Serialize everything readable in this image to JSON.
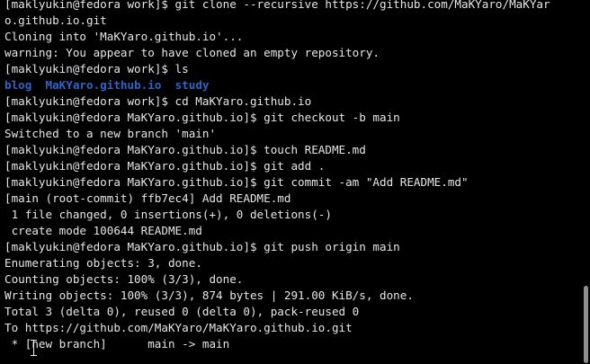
{
  "terminal": {
    "lines": [
      {
        "text": "[maklyukin@fedora work]$ git clone --recursive https://github.com/MaKYaro/MaKYar"
      },
      {
        "text": "o.github.io.git"
      },
      {
        "text": "Cloning into 'MaKYaro.github.io'..."
      },
      {
        "text": "warning: You appear to have cloned an empty repository."
      },
      {
        "text": "[maklyukin@fedora work]$ ls"
      },
      {
        "parts": [
          {
            "text": "blog",
            "style": "dir"
          },
          {
            "text": "  "
          },
          {
            "text": "MaKYaro.github.io",
            "style": "dir"
          },
          {
            "text": "  "
          },
          {
            "text": "study",
            "style": "dir"
          }
        ]
      },
      {
        "text": "[maklyukin@fedora work]$ cd MaKYaro.github.io"
      },
      {
        "text": "[maklyukin@fedora MaKYaro.github.io]$ git checkout -b main"
      },
      {
        "text": "Switched to a new branch 'main'"
      },
      {
        "text": "[maklyukin@fedora MaKYaro.github.io]$ touch README.md"
      },
      {
        "text": "[maklyukin@fedora MaKYaro.github.io]$ git add ."
      },
      {
        "text": "[maklyukin@fedora MaKYaro.github.io]$ git commit -am \"Add README.md\""
      },
      {
        "text": "[main (root-commit) ffb7ec4] Add README.md"
      },
      {
        "text": " 1 file changed, 0 insertions(+), 0 deletions(-)"
      },
      {
        "text": " create mode 100644 README.md"
      },
      {
        "text": "[maklyukin@fedora MaKYaro.github.io]$ git push origin main"
      },
      {
        "text": "Enumerating objects: 3, done."
      },
      {
        "text": "Counting objects: 100% (3/3), done."
      },
      {
        "text": "Writing objects: 100% (3/3), 874 bytes | 291.00 KiB/s, done."
      },
      {
        "text": "Total 3 (delta 0), reused 0 (delta 0), pack-reused 0"
      },
      {
        "text": "To https://github.com/MaKYaro/MaKYaro.github.io.git"
      },
      {
        "text": " * [new branch]      main -> main"
      }
    ]
  },
  "colors": {
    "background": "#000000",
    "foreground": "#e6e6e6",
    "directory": "#2f64c8",
    "scrollbar_thumb": "#8e8e8e"
  },
  "icons": {
    "mouse_cursor": "ibeam-cursor-icon"
  }
}
